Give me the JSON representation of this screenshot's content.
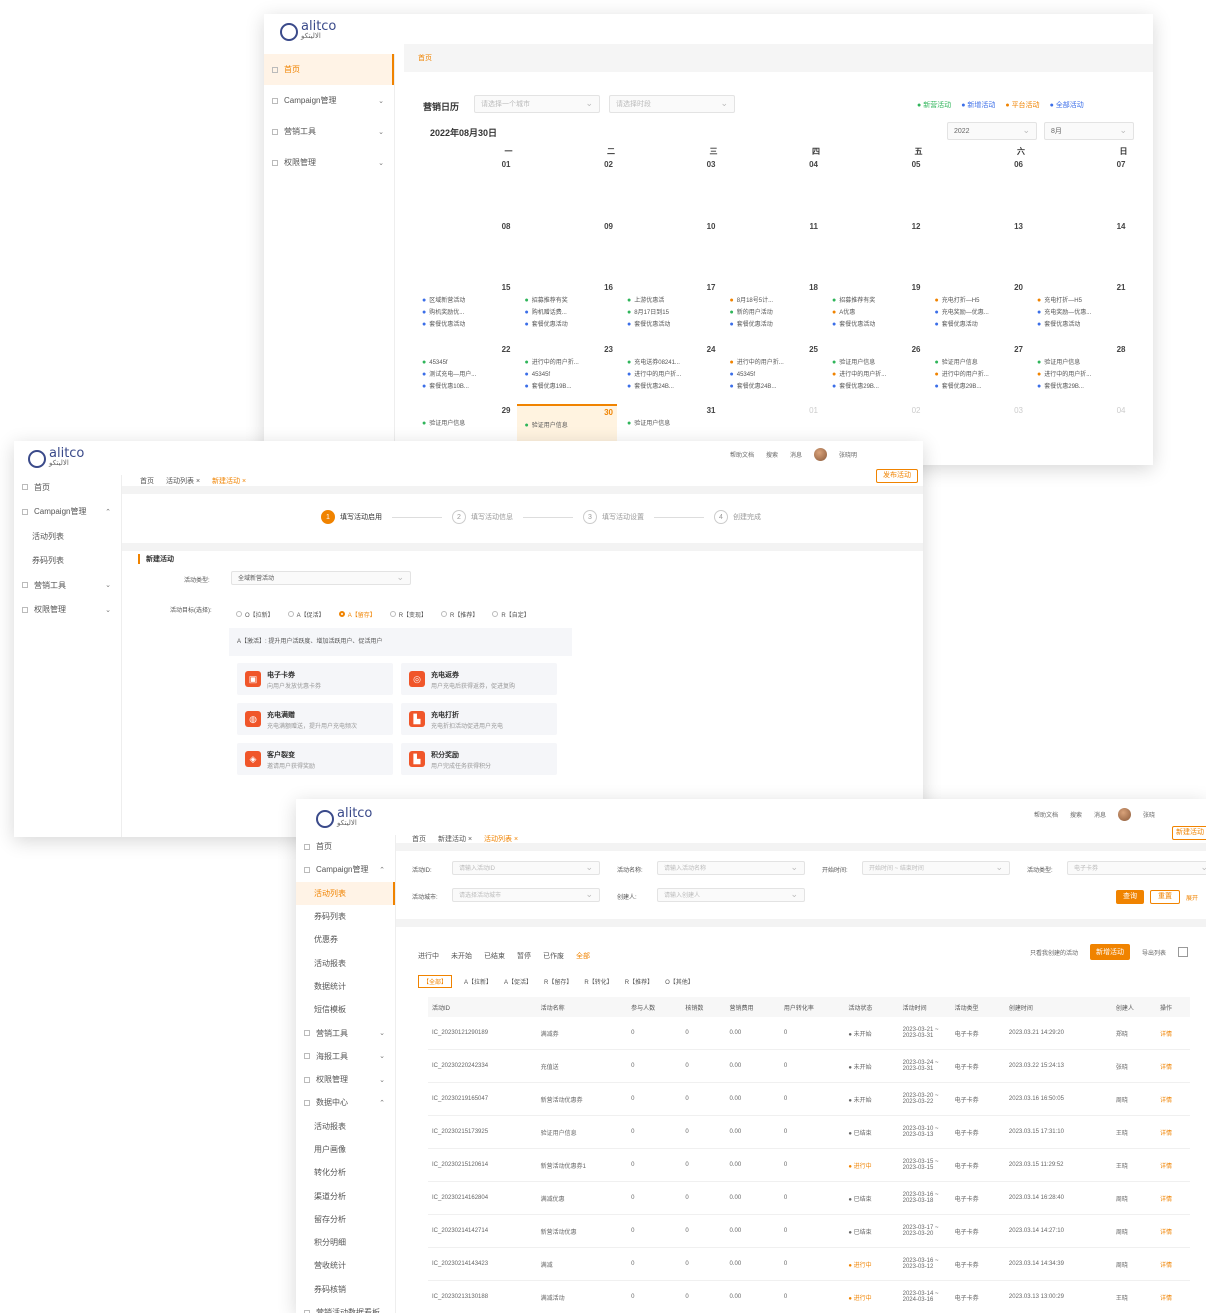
{
  "brand": {
    "name": "alitco",
    "sub": "الاليتكو"
  },
  "w1": {
    "sidebar": [
      {
        "label": "首页",
        "active": true
      },
      {
        "label": "Campaign管理"
      },
      {
        "label": "营销工具"
      },
      {
        "label": "权限管理"
      }
    ],
    "tab": "首页",
    "title": "营销日历",
    "select1": "请选择一个城市",
    "select2": "请选择时段",
    "legend": [
      {
        "label": "新营活动",
        "color": "#2fb55a"
      },
      {
        "label": "新增活动",
        "color": "#3b6ee8"
      },
      {
        "label": "平台活动",
        "color": "#f08300"
      },
      {
        "label": "全部活动",
        "color": "#3b6ee8"
      }
    ],
    "date_title": "2022年08月30日",
    "year": "2022",
    "month": "8月",
    "weekdays": [
      "一",
      "二",
      "三",
      "四",
      "五",
      "六",
      "日"
    ],
    "weeks": [
      [
        {
          "d": "01"
        },
        {
          "d": "02"
        },
        {
          "d": "03"
        },
        {
          "d": "04"
        },
        {
          "d": "05"
        },
        {
          "d": "06"
        },
        {
          "d": "07"
        }
      ],
      [
        {
          "d": "08"
        },
        {
          "d": "09"
        },
        {
          "d": "10"
        },
        {
          "d": "11"
        },
        {
          "d": "12"
        },
        {
          "d": "13"
        },
        {
          "d": "14"
        }
      ],
      [
        {
          "d": "15",
          "ev": [
            [
              "#3b6ee8",
              "区域新营活动"
            ],
            [
              "#3b6ee8",
              "购机奖励优..."
            ],
            [
              "#3b6ee8",
              "套餐优惠活动"
            ]
          ]
        },
        {
          "d": "16",
          "ev": [
            [
              "#2fb55a",
              "招募推荐有奖"
            ],
            [
              "#3b6ee8",
              "购机赠话费..."
            ],
            [
              "#3b6ee8",
              "套餐优惠活动"
            ]
          ]
        },
        {
          "d": "17",
          "ev": [
            [
              "#2fb55a",
              "上游优惠活"
            ],
            [
              "#2fb55a",
              "8月17日到15"
            ],
            [
              "#3b6ee8",
              "套餐优惠活动"
            ]
          ]
        },
        {
          "d": "18",
          "ev": [
            [
              "#f08300",
              "8月18号5计..."
            ],
            [
              "#2fb55a",
              "新的用户活动"
            ],
            [
              "#3b6ee8",
              "套餐优惠活动"
            ]
          ]
        },
        {
          "d": "19",
          "ev": [
            [
              "#2fb55a",
              "招募推荐有奖"
            ],
            [
              "#f08300",
              "A优惠"
            ],
            [
              "#3b6ee8",
              "套餐优惠活动"
            ]
          ]
        },
        {
          "d": "20",
          "ev": [
            [
              "#f08300",
              "充电打折—H5"
            ],
            [
              "#3b6ee8",
              "充电奖励—优惠..."
            ],
            [
              "#3b6ee8",
              "套餐优惠活动"
            ]
          ]
        },
        {
          "d": "21",
          "ev": [
            [
              "#f08300",
              "充电打折—H5"
            ],
            [
              "#3b6ee8",
              "充电奖励—优惠..."
            ],
            [
              "#3b6ee8",
              "套餐优惠活动"
            ]
          ]
        }
      ],
      [
        {
          "d": "22",
          "ev": [
            [
              "#2fb55a",
              "45345f"
            ],
            [
              "#3b6ee8",
              "测试充电—用户..."
            ],
            [
              "#3b6ee8",
              "套餐优惠10B..."
            ]
          ]
        },
        {
          "d": "23",
          "ev": [
            [
              "#2fb55a",
              "进行中的用户折..."
            ],
            [
              "#3b6ee8",
              "45345f"
            ],
            [
              "#3b6ee8",
              "套餐优惠19B..."
            ]
          ]
        },
        {
          "d": "24",
          "ev": [
            [
              "#2fb55a",
              "充电送券08241..."
            ],
            [
              "#3b6ee8",
              "进行中的用户折..."
            ],
            [
              "#3b6ee8",
              "套餐优惠24B..."
            ]
          ]
        },
        {
          "d": "25",
          "ev": [
            [
              "#f08300",
              "进行中的用户折..."
            ],
            [
              "#3b6ee8",
              "45345f"
            ],
            [
              "#3b6ee8",
              "套餐优惠24B..."
            ]
          ]
        },
        {
          "d": "26",
          "ev": [
            [
              "#2fb55a",
              "验证用户信息"
            ],
            [
              "#f08300",
              "进行中的用户折..."
            ],
            [
              "#3b6ee8",
              "套餐优惠29B..."
            ]
          ]
        },
        {
          "d": "27",
          "ev": [
            [
              "#2fb55a",
              "验证用户信息"
            ],
            [
              "#f08300",
              "进行中的用户折..."
            ],
            [
              "#3b6ee8",
              "套餐优惠29B..."
            ]
          ]
        },
        {
          "d": "28",
          "ev": [
            [
              "#2fb55a",
              "验证用户信息"
            ],
            [
              "#f08300",
              "进行中的用户折..."
            ],
            [
              "#3b6ee8",
              "套餐优惠29B..."
            ]
          ]
        }
      ],
      [
        {
          "d": "29",
          "ev": [
            [
              "#2fb55a",
              "验证用户信息"
            ]
          ]
        },
        {
          "d": "30",
          "today": true,
          "ev": [
            [
              "#2fb55a",
              "验证用户信息"
            ]
          ]
        },
        {
          "d": "31",
          "ev": [
            [
              "#2fb55a",
              "验证用户信息"
            ]
          ]
        },
        {
          "d": "01",
          "dim": true
        },
        {
          "d": "02",
          "dim": true
        },
        {
          "d": "03",
          "dim": true
        },
        {
          "d": "04",
          "dim": true
        }
      ]
    ]
  },
  "w2": {
    "sidebar": [
      {
        "label": "首页"
      },
      {
        "label": "Campaign管理",
        "open": true
      },
      {
        "label": "活动列表",
        "sub": true
      },
      {
        "label": "券码列表",
        "sub": true
      },
      {
        "label": "营销工具"
      },
      {
        "label": "权限管理"
      }
    ],
    "tabs": [
      {
        "label": "首页"
      },
      {
        "label": "活动列表 ×"
      },
      {
        "label": "新建活动 ×",
        "on": true
      }
    ],
    "top": {
      "a": "帮助文档",
      "b": "搜索",
      "c": "消息",
      "user": "张晓明"
    },
    "publish_btn": "发布活动",
    "steps": [
      {
        "n": "1",
        "label": "填写活动启用",
        "on": true
      },
      {
        "n": "2",
        "label": "填写活动信息"
      },
      {
        "n": "3",
        "label": "填写活动设置"
      },
      {
        "n": "4",
        "label": "创建完成"
      }
    ],
    "section": "新建活动",
    "f1_label": "活动类型:",
    "f1_value": "全域新营活动",
    "f2_label": "活动目标(选择):",
    "radios": [
      {
        "label": "O【拉新】"
      },
      {
        "label": "A【促活】"
      },
      {
        "label": "A【留存】",
        "on": true
      },
      {
        "label": "R【变现】"
      },
      {
        "label": "R【推荐】"
      },
      {
        "label": "R【自定】"
      }
    ],
    "hint": "A【激活】: 提升用户活跃度、增加活跃用户、促活用户",
    "cards": [
      {
        "t1": "电子卡券",
        "t2": "向用户发放优惠卡券",
        "icon": "▣"
      },
      {
        "t1": "充电返券",
        "t2": "用户充电后获得返券，促进复购",
        "icon": "◎"
      },
      {
        "t1": "充电满赠",
        "t2": "充电满额赠送，提升用户充电频次",
        "icon": "◍"
      },
      {
        "t1": "充电打折",
        "t2": "充电折扣活动促进用户充电",
        "icon": "▙"
      },
      {
        "t1": "客户裂变",
        "t2": "邀请用户获得奖励",
        "icon": "◈"
      },
      {
        "t1": "积分奖励",
        "t2": "用户完成任务获得积分",
        "icon": "▙"
      }
    ]
  },
  "w3": {
    "sidebar": [
      {
        "label": "首页"
      },
      {
        "label": "Campaign管理",
        "open": true
      },
      {
        "label": "活动列表",
        "sub": true,
        "active": true
      },
      {
        "label": "券码列表",
        "sub": true
      },
      {
        "label": "优惠券",
        "sub": true
      },
      {
        "label": "活动报表",
        "sub": true
      },
      {
        "label": "数据统计",
        "sub": true
      },
      {
        "label": "短信模板",
        "sub": true
      },
      {
        "label": "营销工具"
      },
      {
        "label": "海报工具"
      },
      {
        "label": "权限管理"
      },
      {
        "label": "数据中心",
        "open": true
      },
      {
        "label": "活动报表",
        "sub": true
      },
      {
        "label": "用户画像",
        "sub": true
      },
      {
        "label": "转化分析",
        "sub": true
      },
      {
        "label": "渠道分析",
        "sub": true
      },
      {
        "label": "留存分析",
        "sub": true
      },
      {
        "label": "积分明细",
        "sub": true
      },
      {
        "label": "营收统计",
        "sub": true
      },
      {
        "label": "券码核销",
        "sub": true
      },
      {
        "label": "营销活动数据看板"
      }
    ],
    "tabs": [
      {
        "label": "首页"
      },
      {
        "label": "新建活动 ×"
      },
      {
        "label": "活动列表 ×",
        "on": true
      }
    ],
    "top": {
      "a": "帮助文档",
      "b": "搜索",
      "c": "消息",
      "user": "张晓"
    },
    "publish_btn": "新建活动",
    "filters": [
      {
        "label": "活动ID:",
        "ph": "请输入活动ID"
      },
      {
        "label": "活动名称:",
        "ph": "请输入活动名称"
      },
      {
        "label": "开始时间:",
        "ph": "开始时间  ~  结束时间"
      },
      {
        "label": "活动类型:",
        "ph": "电子卡券"
      },
      {
        "label": "活动城市:",
        "ph": "请选择活动城市"
      },
      {
        "label": "创建人:",
        "ph": "请输入创建人"
      }
    ],
    "search_btn": "查询",
    "reset_btn": "重置",
    "expand": "展开",
    "status_tabs": [
      {
        "label": "进行中"
      },
      {
        "label": "未开始"
      },
      {
        "label": "已结束"
      },
      {
        "label": "暂停"
      },
      {
        "label": "已作废"
      },
      {
        "label": "全部",
        "on": true
      }
    ],
    "goal_tabs": [
      {
        "label": "【全部】",
        "on": true
      },
      {
        "label": "A【拉新】"
      },
      {
        "label": "A【促活】"
      },
      {
        "label": "R【留存】"
      },
      {
        "label": "R【转化】"
      },
      {
        "label": "R【推荐】"
      },
      {
        "label": "O【其他】"
      }
    ],
    "right_tools": {
      "a": "只看我创建的活动",
      "b": "新增活动",
      "c": "导出列表"
    },
    "columns": [
      "活动ID",
      "活动名称",
      "参与人数",
      "核销数",
      "营销费用",
      "用户转化率",
      "活动状态",
      "活动时间",
      "活动类型",
      "创建时间",
      "创建人",
      "操作"
    ],
    "rows": [
      [
        "IC_20230121290189",
        "满减券",
        "0",
        "0",
        "0.00",
        "0",
        "● 未开始",
        "2023-03-21 ~ 2023-03-31",
        "电子卡券",
        "2023.03.21 14:29:20",
        "郑晓",
        "详情"
      ],
      [
        "IC_20230220242334",
        "充值送",
        "0",
        "0",
        "0.00",
        "0",
        "● 未开始",
        "2023-03-24 ~ 2023-03-31",
        "电子卡券",
        "2023.03.22 15:24:13",
        "张晓",
        "详情"
      ],
      [
        "IC_20230219165047",
        "新营活动优惠券",
        "0",
        "0",
        "0.00",
        "0",
        "● 未开始",
        "2023-03-20 ~ 2023-03-22",
        "电子卡券",
        "2023.03.16 16:50:05",
        "周晓",
        "详情"
      ],
      [
        "IC_20230215173925",
        "验证用户信息",
        "0",
        "0",
        "0.00",
        "0",
        "● 已结束",
        "2023-03-10 ~ 2023-03-13",
        "电子卡券",
        "2023.03.15 17:31:10",
        "王晓",
        "详情"
      ],
      [
        "IC_20230215120614",
        "新营活动优惠券1",
        "0",
        "0",
        "0.00",
        "0",
        "● 进行中",
        "2023-03-15 ~ 2023-03-15",
        "电子卡券",
        "2023.03.15 11:29:52",
        "王晓",
        "详情"
      ],
      [
        "IC_20230214162804",
        "满减优惠",
        "0",
        "0",
        "0.00",
        "0",
        "● 已结束",
        "2023-03-16 ~ 2023-03-18",
        "电子卡券",
        "2023.03.14 16:28:40",
        "周晓",
        "详情"
      ],
      [
        "IC_20230214142714",
        "新营活动优惠",
        "0",
        "0",
        "0.00",
        "0",
        "● 已结束",
        "2023-03-17 ~ 2023-03-20",
        "电子卡券",
        "2023.03.14 14:27:10",
        "周晓",
        "详情"
      ],
      [
        "IC_20230214143423",
        "满减",
        "0",
        "0",
        "0.00",
        "0",
        "● 进行中",
        "2023-03-16 ~ 2023-03-12",
        "电子卡券",
        "2023.03.14 14:34:39",
        "周晓",
        "详情"
      ],
      [
        "IC_20230213130188",
        "满减活动",
        "0",
        "0",
        "0.00",
        "0",
        "● 进行中",
        "2023-03-14 ~ 2024-03-16",
        "电子卡券",
        "2023.03.13 13:00:29",
        "王晓",
        "详情"
      ]
    ]
  }
}
